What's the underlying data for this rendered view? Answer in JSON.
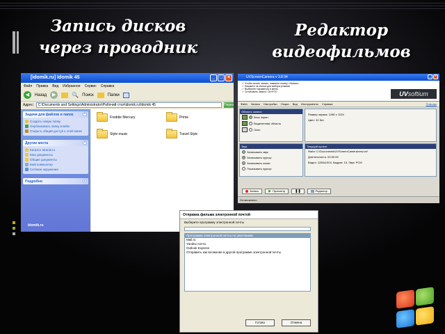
{
  "slide": {
    "title_left": "Запись дисков через проводник",
    "title_right": "Редактор видеофильмов"
  },
  "explorer": {
    "window_title": "[idomik.ru] Idomik 45",
    "menu": [
      "Файл",
      "Правка",
      "Вид",
      "Избранное",
      "Сервис",
      "Справка"
    ],
    "toolbar": {
      "back": "Назад",
      "search": "Поиск",
      "folders": "Папки"
    },
    "address_label": "Адрес:",
    "address_value": "C:\\Documents and Settings\\Administrator\\Рабочий стол\\idomik.ru\\Idomik 45",
    "go_label": "Переход",
    "task_panels": [
      {
        "title": "Задачи для файлов и папок",
        "items": [
          "Создать новую папку",
          "Опубликовать папку в вебе",
          "Открыть общий доступ к этой папке"
        ]
      },
      {
        "title": "Другие места",
        "items": [
          "Каталог Idomik.ru",
          "Мои документы",
          "Общие документы",
          "Мой компьютер",
          "Сетевое окружение"
        ]
      },
      {
        "title": "Подробно",
        "items": []
      }
    ],
    "footer_text": "idomik.ru",
    "folders": [
      "Freddie Mercury",
      "Prime",
      "Style music",
      "Travel Style"
    ]
  },
  "uv_editor": {
    "window_title": "UVScreenCamera v 3.8.94",
    "header_lines": [
      "✓ Чтобы начать запись, нажмите кнопку «Запись»",
      "✓ Нажмите на значок для выбора режима",
      "✓ Выберите параметры в меню",
      "✓ Остановить запись: Ctrl+F10"
    ],
    "logo_main": "UV",
    "logo_sub": "softium",
    "help_label": "Помощь",
    "menu": [
      "Файл",
      "Запись",
      "Настройки",
      "Опции",
      "Вид",
      "Инструменты",
      "Справка"
    ],
    "capture_group": {
      "title": "Область записи",
      "options": [
        "Весь экран",
        "Выделенная область",
        "Окно"
      ]
    },
    "capture_info": [
      "Размер экрана: 1280 x 1024",
      "Цвет: 32 бит"
    ],
    "sound_group": {
      "title": "Звук",
      "options": [
        "Записывать звук",
        "Записывать курсор",
        "Записывать клики",
        "Показывать курсор"
      ]
    },
    "current_group": {
      "title": "Текущий проект",
      "lines": [
        "Файл: C:\\Documents\\UVScreenCamera\\new.uvf",
        "Длительность: 00:00:00",
        "Видео: 1280x1024, Кадров: 15, Звук: PCM"
      ]
    },
    "buttons": [
      "Запись",
      "Просмотр",
      "Редактор"
    ],
    "status": "Остановлено"
  },
  "send_dialog": {
    "title": "Отправка фильма электронной почтой",
    "label": "Выберите программу электронной почты",
    "list_header": "Программа электронной почты по умолчанию",
    "list_items": [
      "Mail.ru",
      "Yandex почта",
      "Outlook Express",
      "Отправить как вложение в другой программе электронной почты"
    ],
    "ok": "Готово",
    "cancel": "Отмена"
  },
  "colors": {
    "background": "#050506",
    "xp_blue": "#0a4fd1",
    "task_blue": "#6375d6",
    "folder_yellow": "#f0c53c"
  },
  "icons": {
    "windows_logo": "windows-flag-icon",
    "folder": "folder-icon"
  }
}
